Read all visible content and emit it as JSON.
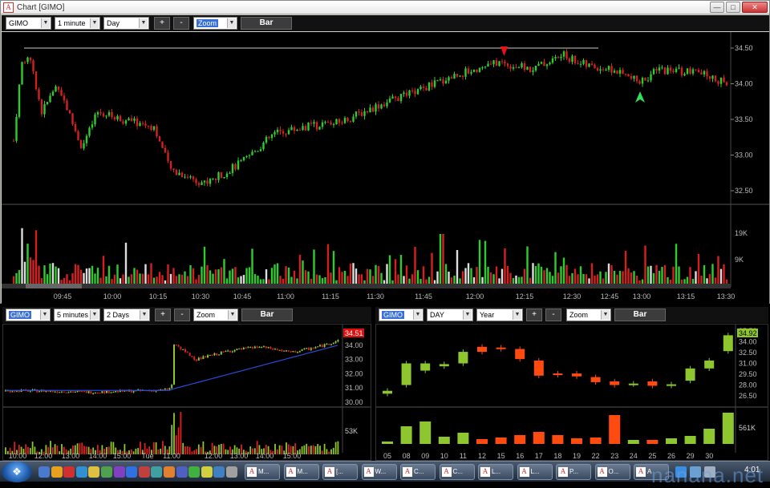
{
  "window": {
    "title": "Chart [GIMO]",
    "app_icon": "A"
  },
  "main": {
    "symbol": "GIMO",
    "interval": "1 minute",
    "range": "Day",
    "zoom": "Zoom",
    "plus": "+",
    "minus": "-",
    "bar": "Bar",
    "price_ticks": [
      "34.50",
      "34.00",
      "33.50",
      "33.00",
      "32.50"
    ],
    "volume_ticks": [
      "19K",
      "9K"
    ],
    "time_ticks": [
      "09:45",
      "10:00",
      "10:15",
      "10:30",
      "10:45",
      "11:00",
      "11:15",
      "11:30",
      "11:45",
      "12:00",
      "12:15",
      "12:30",
      "12:45",
      "13:00",
      "13:15",
      "13:30"
    ]
  },
  "left": {
    "symbol": "GIMO",
    "interval": "5 minutes",
    "range": "2 Days",
    "zoom": "Zoom",
    "plus": "+",
    "minus": "-",
    "bar": "Bar",
    "price_ticks": [
      "34.00",
      "33.00",
      "32.00",
      "31.00",
      "30.00"
    ],
    "last_price": "34.51",
    "volume_tick": "53K",
    "time_ticks": [
      "10:00",
      "12:00",
      "13:00",
      "14:00",
      "15:00",
      "Tue",
      "11:00",
      "12:00",
      "13:00",
      "14:00",
      "15:00"
    ]
  },
  "right": {
    "symbol": "GIMO",
    "interval": "DAY",
    "range": "Year",
    "zoom": "Zoom",
    "plus": "+",
    "minus": "-",
    "bar": "Bar",
    "price_ticks": [
      "35.50",
      "34.92",
      "34.00",
      "32.50",
      "31.00",
      "29.50",
      "28.00",
      "26.50"
    ],
    "last_price": "34.92",
    "volume_tick": "561K",
    "date_ticks": [
      "05",
      "08",
      "09",
      "10",
      "11",
      "12",
      "15",
      "16",
      "17",
      "18",
      "19",
      "22",
      "23",
      "24",
      "25",
      "26",
      "29",
      "30"
    ]
  },
  "taskbar": {
    "tasks": [
      "M...",
      "M...",
      "[...",
      "W...",
      "C...",
      "C...",
      "L...",
      "L...",
      "P...",
      "O...",
      "A"
    ],
    "clock": "4:01",
    "watermark": "nanana.net"
  },
  "colors": {
    "up": "#2ecc2e",
    "down": "#d42020",
    "daily_up": "#8ec630",
    "daily_down": "#ff4a10",
    "ma": "#2a4bd8"
  }
}
